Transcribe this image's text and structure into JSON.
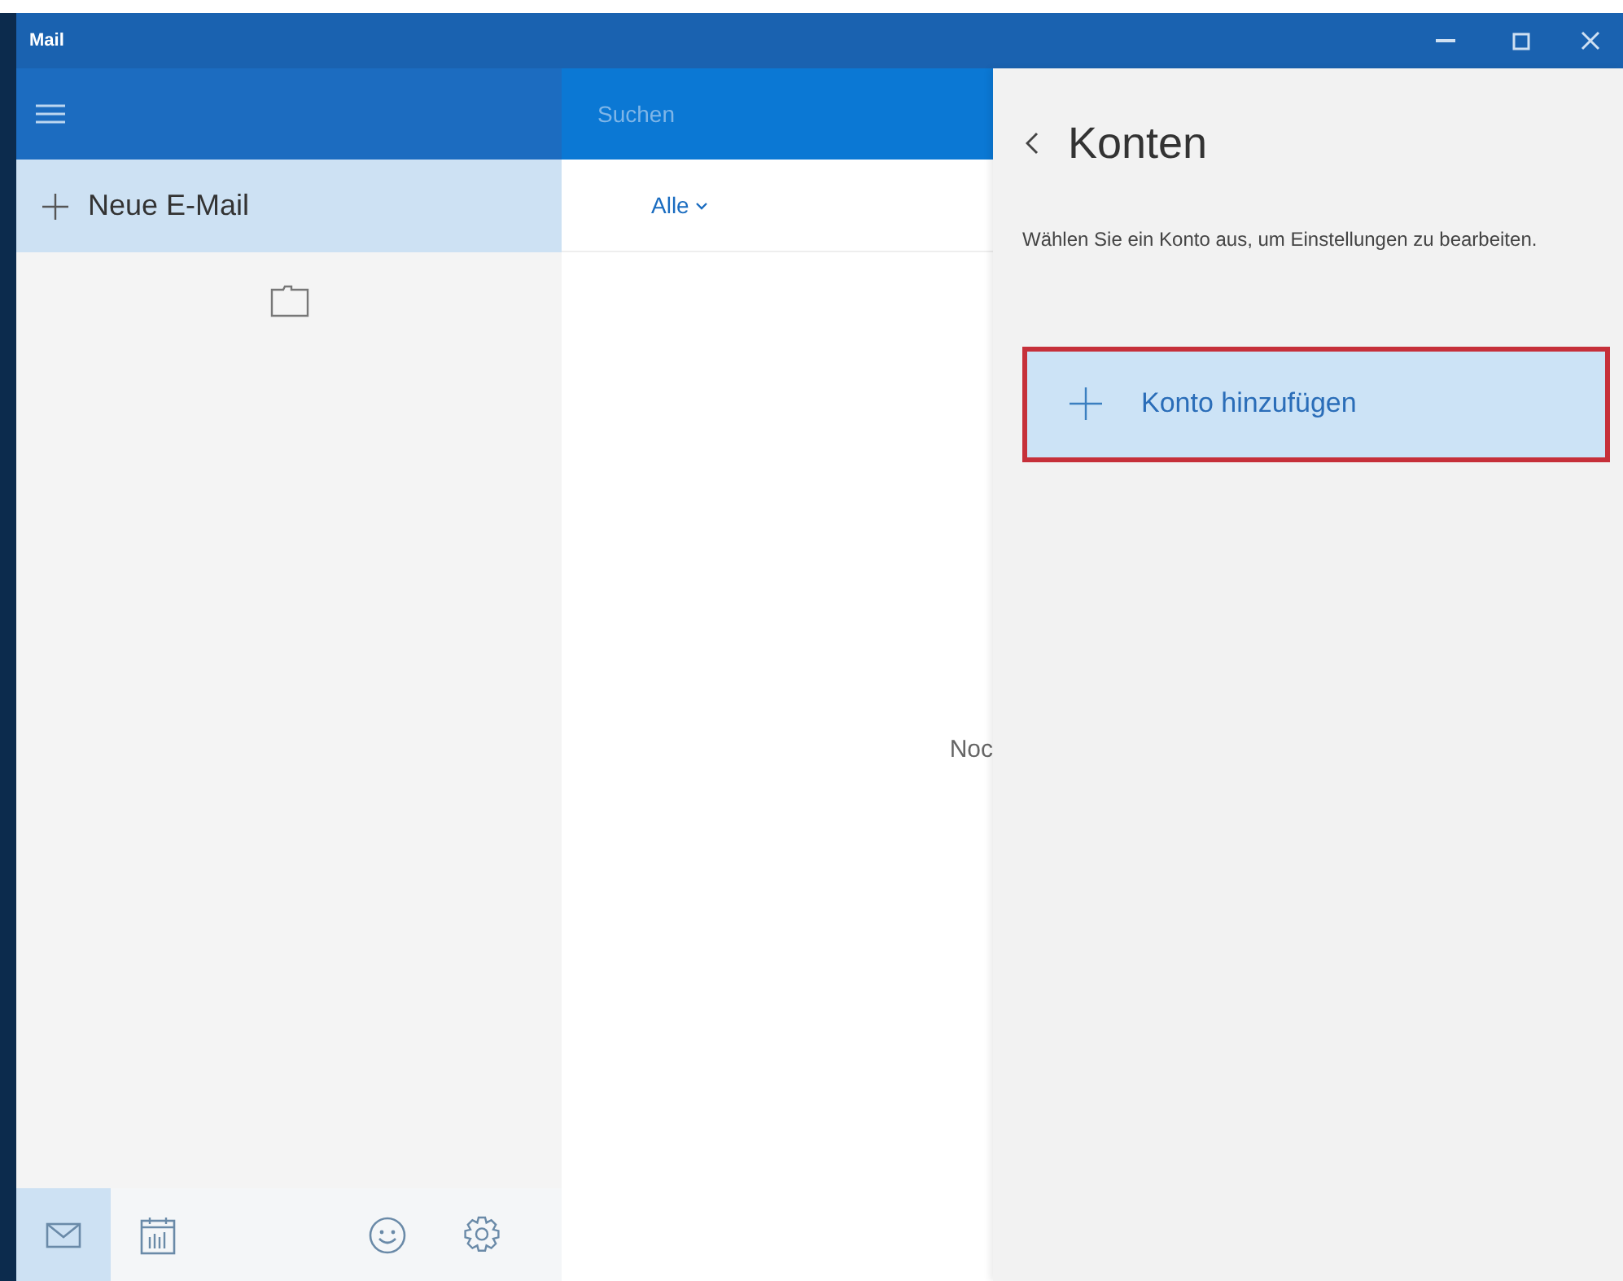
{
  "window": {
    "title": "Mail"
  },
  "sidebar": {
    "compose_label": "Neue E-Mail",
    "nav": [
      {
        "kind": "mail",
        "selected": true
      },
      {
        "kind": "calendar",
        "selected": false
      },
      {
        "kind": "smiley",
        "selected": false
      },
      {
        "kind": "settings",
        "selected": false
      }
    ]
  },
  "message_list": {
    "search": {
      "placeholder": "Suchen"
    },
    "filter": "Alle",
    "empty_text": "Noc"
  },
  "accounts_panel": {
    "title": "Konten",
    "description": "Wählen Sie ein Konto aus, um Einstellungen zu bearbeiten.",
    "add_button": {
      "label": "Konto hinzufügen",
      "highlighted": true
    }
  }
}
